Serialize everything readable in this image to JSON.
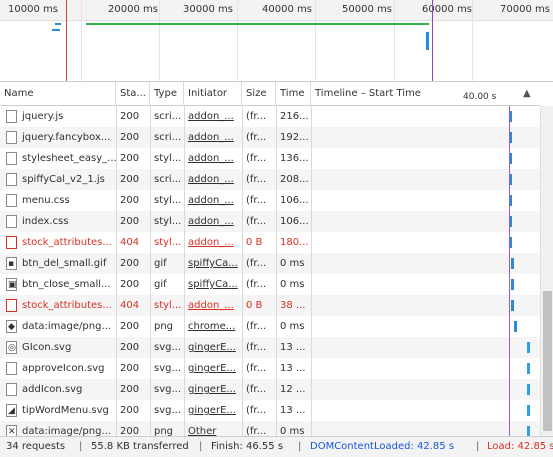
{
  "overview": {
    "ticks": [
      "10000 ms",
      "20000 ms",
      "30000 ms",
      "40000 ms",
      "50000 ms",
      "60000 ms",
      "70000 ms"
    ]
  },
  "columns": {
    "name": "Name",
    "status": "Sta...",
    "type": "Type",
    "initiator": "Initiator",
    "size": "Size",
    "time": "Time",
    "timeline": "Timeline – Start Time",
    "timeline_marker": "40.00 s",
    "sort_arrow": "▲"
  },
  "rows": [
    {
      "name": "jquery.js",
      "status": "200",
      "type": "scri...",
      "initiator": "addon_...",
      "size": "(fr...",
      "time": "216...",
      "icon": "document-icon",
      "error": false
    },
    {
      "name": "jquery.fancybox...",
      "status": "200",
      "type": "scri...",
      "initiator": "addon_...",
      "size": "(fr...",
      "time": "192...",
      "icon": "document-icon",
      "error": false
    },
    {
      "name": "stylesheet_easy_...",
      "status": "200",
      "type": "styl...",
      "initiator": "addon_...",
      "size": "(fr...",
      "time": "136...",
      "icon": "document-icon",
      "error": false
    },
    {
      "name": "spiffyCal_v2_1.js",
      "status": "200",
      "type": "scri...",
      "initiator": "addon_...",
      "size": "(fr...",
      "time": "208...",
      "icon": "document-icon",
      "error": false
    },
    {
      "name": "menu.css",
      "status": "200",
      "type": "styl...",
      "initiator": "addon_...",
      "size": "(fr...",
      "time": "106...",
      "icon": "document-icon",
      "error": false
    },
    {
      "name": "index.css",
      "status": "200",
      "type": "styl...",
      "initiator": "addon_...",
      "size": "(fr...",
      "time": "106...",
      "icon": "document-icon",
      "error": false
    },
    {
      "name": "stock_attributes...",
      "status": "404",
      "type": "styl...",
      "initiator": "addon_...",
      "size": "0 B",
      "time": "180...",
      "icon": "document-icon",
      "error": true
    },
    {
      "name": "btn_del_small.gif",
      "status": "200",
      "type": "gif",
      "initiator": "spiffyCa...",
      "size": "(fr...",
      "time": "0 ms",
      "icon": "image-icon",
      "error": false
    },
    {
      "name": "btn_close_small...",
      "status": "200",
      "type": "gif",
      "initiator": "spiffyCa...",
      "size": "(fr...",
      "time": "0 ms",
      "icon": "close-image-icon",
      "error": false
    },
    {
      "name": "stock_attributes...",
      "status": "404",
      "type": "styl...",
      "initiator": "addon_...",
      "size": "0 B",
      "time": "38 ...",
      "icon": "document-icon",
      "error": true
    },
    {
      "name": "data:image/png...",
      "status": "200",
      "type": "png",
      "initiator": "chrome...",
      "size": "(fr...",
      "time": "0 ms",
      "icon": "diamond-image-icon",
      "error": false
    },
    {
      "name": "GIcon.svg",
      "status": "200",
      "type": "svg...",
      "initiator": "gingerE...",
      "size": "(fr...",
      "time": "13 ...",
      "icon": "svg-g-icon",
      "error": false
    },
    {
      "name": "approveIcon.svg",
      "status": "200",
      "type": "svg...",
      "initiator": "gingerE...",
      "size": "(fr...",
      "time": "13 ...",
      "icon": "document-icon",
      "error": false
    },
    {
      "name": "addIcon.svg",
      "status": "200",
      "type": "svg...",
      "initiator": "gingerE...",
      "size": "(fr...",
      "time": "12 ...",
      "icon": "document-icon",
      "error": false
    },
    {
      "name": "tipWordMenu.svg",
      "status": "200",
      "type": "svg...",
      "initiator": "gingerE...",
      "size": "(fr...",
      "time": "13 ...",
      "icon": "chart-image-icon",
      "error": false
    },
    {
      "name": "data:image/png...",
      "status": "200",
      "type": "png",
      "initiator": "Other",
      "size": "(fr...",
      "time": "0 ms",
      "icon": "x-image-icon",
      "error": false
    }
  ],
  "status_bar": {
    "requests": "34 requests",
    "transferred": "55.8 KB transferred",
    "finish": "Finish: 46.55 s",
    "dom_content_loaded": "DOMContentLoaded: 42.85 s",
    "load": "Load: 42.85 s",
    "separator": "|"
  },
  "colors": {
    "error_text": "#d93025",
    "dom_content_loaded": "#1a56d6",
    "load": "#d93025",
    "waterfall_bar": "#2a8ad6"
  }
}
